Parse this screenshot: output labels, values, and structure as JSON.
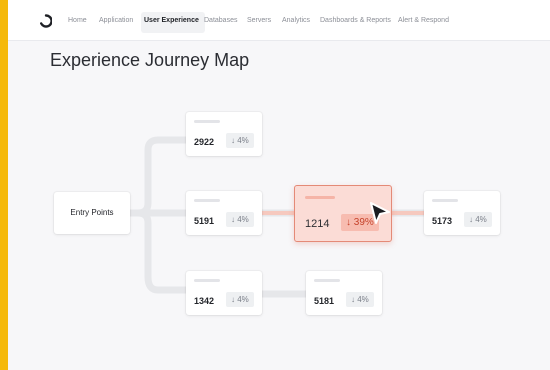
{
  "nav": {
    "items": [
      {
        "label": "Home"
      },
      {
        "label": "Application"
      },
      {
        "label": "User Experience",
        "active": true
      },
      {
        "label": "Databases"
      },
      {
        "label": "Servers"
      },
      {
        "label": "Analytics"
      },
      {
        "label": "Dashboards & Reports"
      },
      {
        "label": "Alert & Respond"
      }
    ]
  },
  "page": {
    "title": "Experience Journey Map"
  },
  "journey": {
    "entry_label": "Entry Points",
    "nodes": [
      {
        "value": "2922",
        "delta": "↓ 4%"
      },
      {
        "value": "5191",
        "delta": "↓ 4%"
      },
      {
        "value": "1342",
        "delta": "↓ 4%"
      },
      {
        "value": "1214",
        "delta": "↓ 39%",
        "highlighted": true
      },
      {
        "value": "5173",
        "delta": "↓ 4%"
      },
      {
        "value": "5181",
        "delta": "↓ 4%"
      }
    ]
  },
  "colors": {
    "outer_border": "#f5b90a",
    "highlight_fill": "#fbdcd6",
    "highlight_border": "#e48a77",
    "decline_text": "#c6432b"
  }
}
